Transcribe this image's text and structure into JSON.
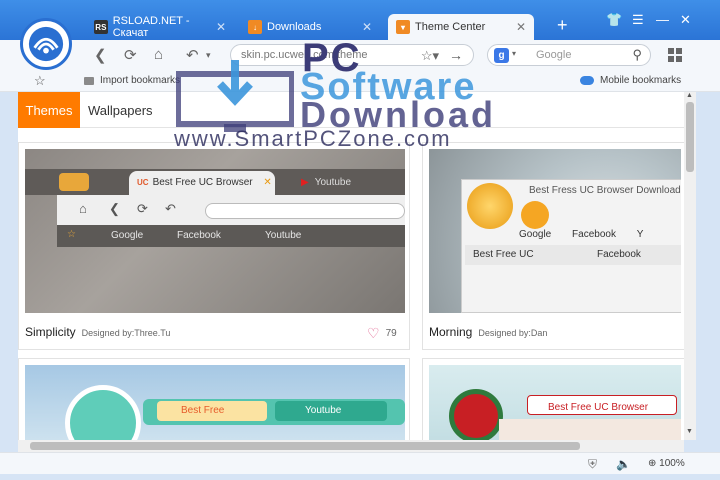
{
  "tabs": [
    {
      "label": "RSLOAD.NET - Скачат",
      "icon": "RS",
      "color": "#333333"
    },
    {
      "label": "Downloads",
      "icon": "download-icon",
      "color": "#f08a24"
    },
    {
      "label": "Theme Center",
      "icon": "theme-icon",
      "color": "#f08a24",
      "active": true
    }
  ],
  "address": {
    "value": "skin.pc.ucweb.com/theme"
  },
  "search": {
    "placeholder": "Google"
  },
  "bookmarks": {
    "import": "Import bookmarks",
    "mobile": "Mobile bookmarks"
  },
  "theme_tabs": {
    "themes": "Themes",
    "wallpapers": "Wallpapers"
  },
  "cards": [
    {
      "name": "Simplicity",
      "designer": "Designed by:Three.Tu",
      "likes": "79",
      "preview": {
        "tab1": "Best Free UC Browser",
        "tab2": "Youtube",
        "bm1": "Google",
        "bm2": "Facebook",
        "bm3": "Youtube"
      }
    },
    {
      "name": "Morning",
      "designer": "Designed by:Dan",
      "preview": {
        "title": "Best Fress UC Browser Download -",
        "bm1": "Google",
        "bm2": "Facebook",
        "bm3": "Y",
        "tab1": "Best Free UC",
        "tab2": "Facebook"
      }
    },
    {
      "preview": {
        "tab1": "Best Free",
        "tab2": "Youtube"
      }
    },
    {
      "preview": {
        "tab1": "Best Free UC Browser"
      }
    }
  ],
  "status": {
    "zoom": "100%"
  },
  "watermark": {
    "pc": "PC",
    "software": "Software",
    "download": "Download",
    "site": "www.SmartPCZone.com"
  },
  "colors": {
    "accent": "#ff7b00",
    "titlebar": "#2b74d6"
  }
}
